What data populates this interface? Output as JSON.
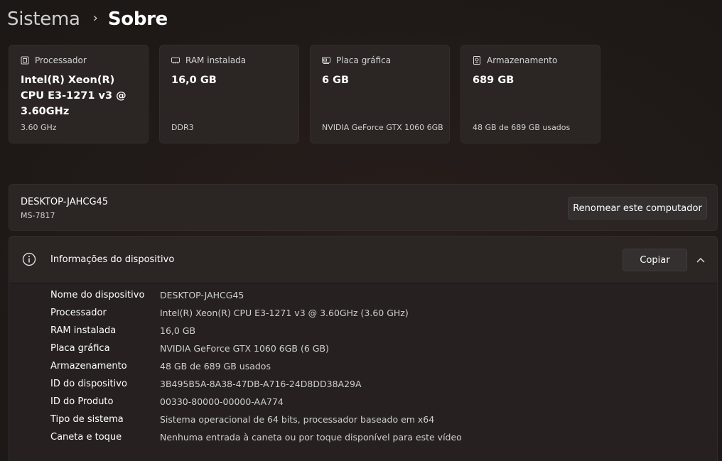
{
  "breadcrumb": {
    "parent": "Sistema",
    "separator": "›",
    "current": "Sobre"
  },
  "cards": [
    {
      "label": "Processador",
      "icon": "cpu-icon",
      "value": "Intel(R) Xeon(R) CPU E3-1271 v3 @ 3.60GHz",
      "sub": "3.60 GHz"
    },
    {
      "label": "RAM instalada",
      "icon": "ram-icon",
      "value": "16,0 GB",
      "sub": "DDR3"
    },
    {
      "label": "Placa gráfica",
      "icon": "gpu-icon",
      "value": "6 GB",
      "sub": "NVIDIA GeForce GTX 1060 6GB"
    },
    {
      "label": "Armazenamento",
      "icon": "storage-icon",
      "value": "689 GB",
      "sub": "48 GB de 689 GB usados"
    }
  ],
  "device": {
    "name": "DESKTOP-JAHCG45",
    "model": "MS-7817",
    "rename_label": "Renomear este computador"
  },
  "info": {
    "title": "Informações do dispositivo",
    "copy_label": "Copiar",
    "rows": [
      {
        "label": "Nome do dispositivo",
        "value": "DESKTOP-JAHCG45"
      },
      {
        "label": "Processador",
        "value": "Intel(R) Xeon(R) CPU E3-1271 v3 @ 3.60GHz (3.60 GHz)"
      },
      {
        "label": "RAM instalada",
        "value": "16,0 GB"
      },
      {
        "label": "Placa gráfica",
        "value": "NVIDIA GeForce GTX 1060 6GB (6 GB)"
      },
      {
        "label": "Armazenamento",
        "value": "48 GB de 689 GB usados"
      },
      {
        "label": "ID do dispositivo",
        "value": "3B495B5A-8A38-47DB-A716-24D8DD38A29A"
      },
      {
        "label": "ID do Produto",
        "value": "00330-80000-00000-AA774"
      },
      {
        "label": "Tipo de sistema",
        "value": "Sistema operacional de 64 bits, processador baseado em x64"
      },
      {
        "label": "Caneta e toque",
        "value": "Nenhuma entrada à caneta ou por toque disponível para este vídeo"
      }
    ]
  },
  "colors": {
    "background": "#211b19",
    "card": "#2b2524",
    "button": "#353030",
    "text": "#ffffff",
    "muted": "#cfcfcf"
  }
}
